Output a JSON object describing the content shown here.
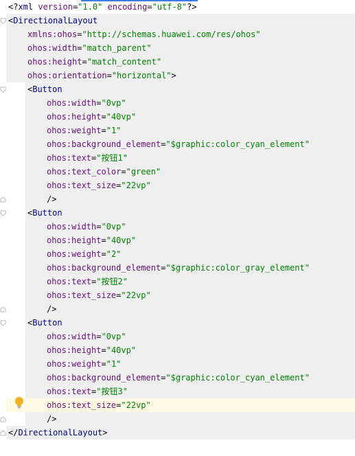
{
  "editor": {
    "language": "xml",
    "lines": [
      {
        "kind": "decl",
        "parts": [
          [
            "punct",
            "<?"
          ],
          [
            "tag",
            "xml "
          ],
          [
            "attr",
            "version"
          ],
          [
            "eq",
            "="
          ],
          [
            "val",
            "\"1.0\""
          ],
          [
            "tag",
            " "
          ],
          [
            "attr",
            "encoding"
          ],
          [
            "eq",
            "="
          ],
          [
            "val",
            "\"utf-8\""
          ],
          [
            "punct",
            "?>"
          ]
        ]
      },
      {
        "kind": "open",
        "parts": [
          [
            "punct",
            "<"
          ],
          [
            "tag",
            "DirectionalLayout"
          ]
        ]
      },
      {
        "kind": "attr",
        "parts": [
          [
            "attr",
            "xmlns:ohos"
          ],
          [
            "eq",
            "="
          ],
          [
            "val",
            "\"http://schemas.huawei.com/res/ohos\""
          ]
        ]
      },
      {
        "kind": "attr",
        "parts": [
          [
            "attr",
            "ohos:width"
          ],
          [
            "eq",
            "="
          ],
          [
            "val",
            "\"match_parent\""
          ]
        ]
      },
      {
        "kind": "attr",
        "parts": [
          [
            "attr",
            "ohos:height"
          ],
          [
            "eq",
            "="
          ],
          [
            "val",
            "\"match_content\""
          ]
        ]
      },
      {
        "kind": "attr",
        "parts": [
          [
            "attr",
            "ohos:orientation"
          ],
          [
            "eq",
            "="
          ],
          [
            "val",
            "\"horizontal\""
          ],
          [
            "punct",
            ">"
          ]
        ]
      },
      {
        "kind": "open",
        "parts": [
          [
            "punct",
            "<"
          ],
          [
            "tag",
            "Button"
          ]
        ]
      },
      {
        "kind": "attr",
        "parts": [
          [
            "attr",
            "ohos:width"
          ],
          [
            "eq",
            "="
          ],
          [
            "val",
            "\"0vp\""
          ]
        ]
      },
      {
        "kind": "attr",
        "parts": [
          [
            "attr",
            "ohos:height"
          ],
          [
            "eq",
            "="
          ],
          [
            "val",
            "\"40vp\""
          ]
        ]
      },
      {
        "kind": "attr",
        "parts": [
          [
            "attr",
            "ohos:weight"
          ],
          [
            "eq",
            "="
          ],
          [
            "val",
            "\"1\""
          ]
        ]
      },
      {
        "kind": "attr",
        "parts": [
          [
            "attr",
            "ohos:background_element"
          ],
          [
            "eq",
            "="
          ],
          [
            "val",
            "\"$graphic:color_cyan_element\""
          ]
        ]
      },
      {
        "kind": "attr",
        "parts": [
          [
            "attr",
            "ohos:text"
          ],
          [
            "eq",
            "="
          ],
          [
            "val",
            "\"按钮1\""
          ]
        ]
      },
      {
        "kind": "attr",
        "parts": [
          [
            "attr",
            "ohos:text_color"
          ],
          [
            "eq",
            "="
          ],
          [
            "val",
            "\"green\""
          ]
        ]
      },
      {
        "kind": "attr",
        "parts": [
          [
            "attr",
            "ohos:text_size"
          ],
          [
            "eq",
            "="
          ],
          [
            "val",
            "\"22vp\""
          ]
        ]
      },
      {
        "kind": "close",
        "parts": [
          [
            "punct",
            "/>"
          ]
        ]
      },
      {
        "kind": "open",
        "parts": [
          [
            "punct",
            "<"
          ],
          [
            "tag",
            "Button"
          ]
        ]
      },
      {
        "kind": "attr",
        "parts": [
          [
            "attr",
            "ohos:width"
          ],
          [
            "eq",
            "="
          ],
          [
            "val",
            "\"0vp\""
          ]
        ]
      },
      {
        "kind": "attr",
        "parts": [
          [
            "attr",
            "ohos:height"
          ],
          [
            "eq",
            "="
          ],
          [
            "val",
            "\"40vp\""
          ]
        ]
      },
      {
        "kind": "attr",
        "parts": [
          [
            "attr",
            "ohos:weight"
          ],
          [
            "eq",
            "="
          ],
          [
            "val",
            "\"2\""
          ]
        ]
      },
      {
        "kind": "attr",
        "parts": [
          [
            "attr",
            "ohos:background_element"
          ],
          [
            "eq",
            "="
          ],
          [
            "val",
            "\"$graphic:color_gray_element\""
          ]
        ]
      },
      {
        "kind": "attr",
        "parts": [
          [
            "attr",
            "ohos:text"
          ],
          [
            "eq",
            "="
          ],
          [
            "val",
            "\"按钮2\""
          ]
        ]
      },
      {
        "kind": "attr",
        "parts": [
          [
            "attr",
            "ohos:text_size"
          ],
          [
            "eq",
            "="
          ],
          [
            "val",
            "\"22vp\""
          ]
        ]
      },
      {
        "kind": "close",
        "parts": [
          [
            "punct",
            "/>"
          ]
        ]
      },
      {
        "kind": "open",
        "parts": [
          [
            "punct",
            "<"
          ],
          [
            "tag",
            "Button"
          ]
        ]
      },
      {
        "kind": "attr",
        "parts": [
          [
            "attr",
            "ohos:width"
          ],
          [
            "eq",
            "="
          ],
          [
            "val",
            "\"0vp\""
          ]
        ]
      },
      {
        "kind": "attr",
        "parts": [
          [
            "attr",
            "ohos:height"
          ],
          [
            "eq",
            "="
          ],
          [
            "val",
            "\"40vp\""
          ]
        ]
      },
      {
        "kind": "attr",
        "parts": [
          [
            "attr",
            "ohos:weight"
          ],
          [
            "eq",
            "="
          ],
          [
            "val",
            "\"1\""
          ]
        ]
      },
      {
        "kind": "attr",
        "parts": [
          [
            "attr",
            "ohos:background_element"
          ],
          [
            "eq",
            "="
          ],
          [
            "val",
            "\"$graphic:color_cyan_element\""
          ]
        ]
      },
      {
        "kind": "attr",
        "parts": [
          [
            "attr",
            "ohos:text"
          ],
          [
            "eq",
            "="
          ],
          [
            "val",
            "\"按钮3\""
          ]
        ]
      },
      {
        "kind": "attr",
        "parts": [
          [
            "attr",
            "ohos:text_size"
          ],
          [
            "eq",
            "="
          ],
          [
            "val",
            "\"22vp\""
          ]
        ]
      },
      {
        "kind": "close",
        "parts": [
          [
            "punct",
            "/>"
          ]
        ]
      },
      {
        "kind": "closeroot",
        "parts": [
          [
            "punct",
            "</"
          ],
          [
            "tag",
            "DirectionalLayout"
          ],
          [
            "punct",
            ">"
          ]
        ]
      }
    ]
  },
  "icons": {
    "fold_markers": "fold-icon",
    "intention": "lightbulb-icon"
  },
  "colors": {
    "tag": "#000080",
    "attribute": "#660e7a",
    "value": "#008000",
    "block_bg": "#efefef",
    "highlighted_line_bg": "#fffae3"
  }
}
